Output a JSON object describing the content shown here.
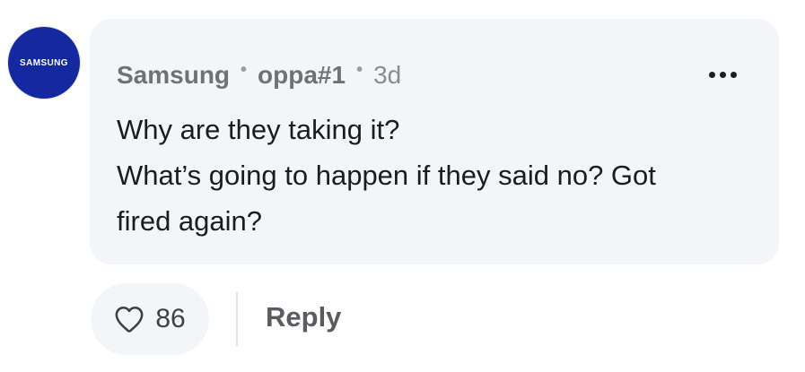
{
  "comment": {
    "avatar": {
      "text": "SAMSUNG",
      "color": "#1428a0"
    },
    "author": "Samsung",
    "badge": "oppa#1",
    "separator": "•",
    "time": "3d",
    "lines": [
      "Why are they taking it?",
      "What’s going to happen if they said no? Got",
      "fired again?"
    ],
    "more_icon": "more-horizontal-icon",
    "like_icon": "heart-outline-icon",
    "likes": "86",
    "reply_label": "Reply"
  },
  "colors": {
    "bubble_bg": "#f4f5f8",
    "text": "#1b1c1f",
    "meta": "#6f7177",
    "brand": "#1428a0"
  }
}
